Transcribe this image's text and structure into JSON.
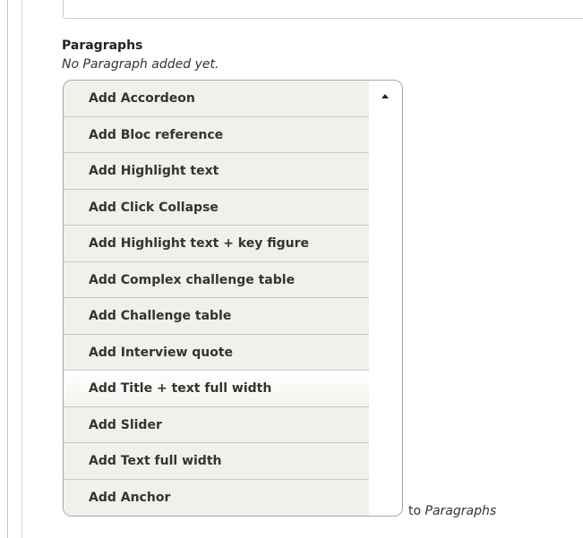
{
  "field": {
    "label": "Paragraphs",
    "description": "No Paragraph added yet."
  },
  "dropbutton": {
    "items": [
      {
        "label": "Add Accordeon"
      },
      {
        "label": "Add Bloc reference"
      },
      {
        "label": "Add Highlight text"
      },
      {
        "label": "Add Click Collapse"
      },
      {
        "label": "Add Highlight text + key figure"
      },
      {
        "label": "Add Complex challenge table"
      },
      {
        "label": "Add Challenge table"
      },
      {
        "label": "Add Interview quote"
      },
      {
        "label": "Add Title + text full width"
      },
      {
        "label": "Add Slider"
      },
      {
        "label": "Add Text full width"
      },
      {
        "label": "Add Anchor"
      }
    ],
    "toggle_icon": "chevron-up-icon"
  },
  "suffix": {
    "prefix_text": "to",
    "target_text": "Paragraphs"
  },
  "colors": {
    "item_background": "#f1f0ea",
    "border": "#a6a6a6",
    "text": "#333333"
  }
}
